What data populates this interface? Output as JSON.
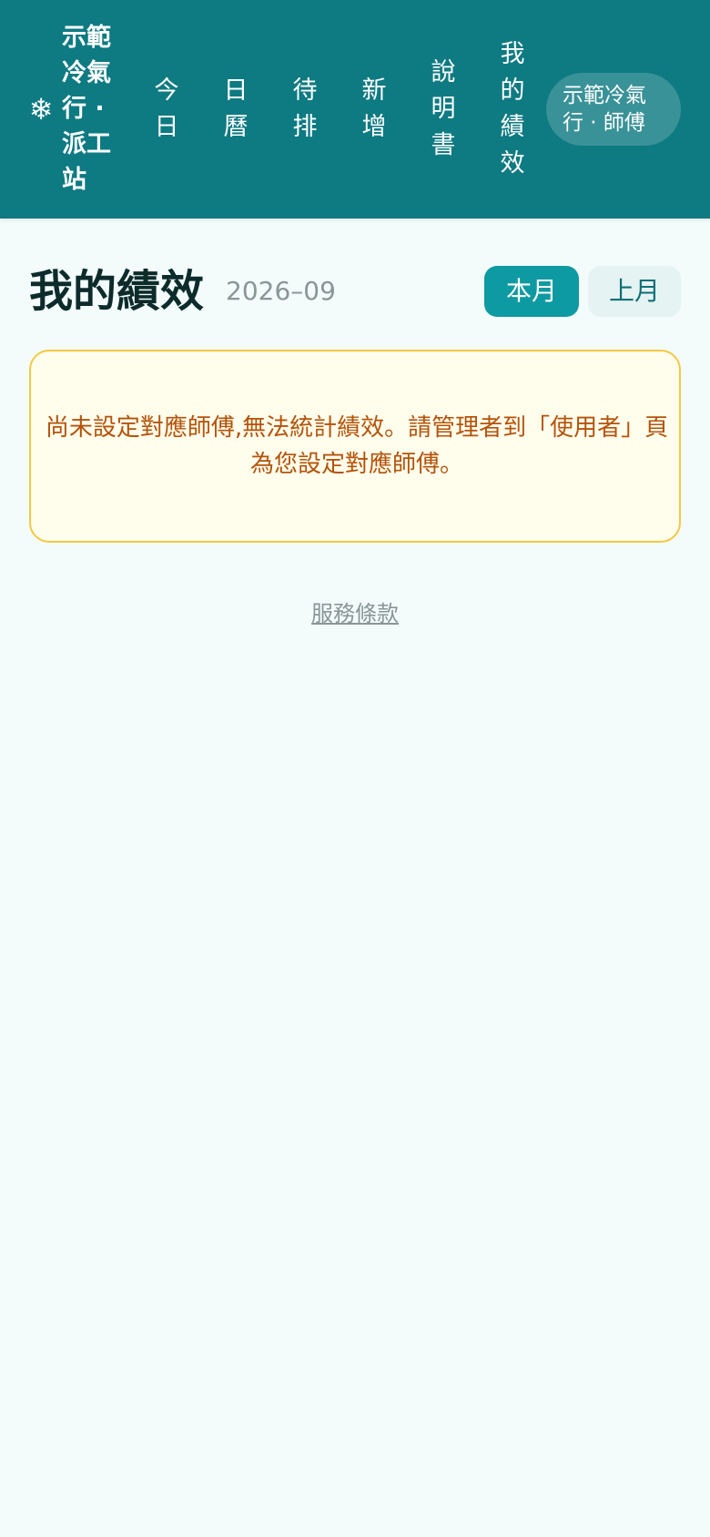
{
  "header": {
    "brand_icon": "❄",
    "brand_icon_name": "snowflake-icon",
    "brand_name": "示範冷氣行 · 派工站",
    "nav": [
      {
        "label": "今日"
      },
      {
        "label": "日曆"
      },
      {
        "label": "待排"
      },
      {
        "label": "新增"
      },
      {
        "label": "說明書"
      },
      {
        "label": "我的績效"
      }
    ],
    "user_label": "示範冷氣行 · 師傅"
  },
  "main": {
    "title": "我的績效",
    "period": "2026–09",
    "buttons": {
      "this_month": "本月",
      "last_month": "上月"
    },
    "notice": "尚未設定對應師傅,無法統計績效。請管理者到「使用者」頁為您設定對應師傅。"
  },
  "footer": {
    "terms_link": "服務條款"
  },
  "colors": {
    "header_bg": "#0e7a82",
    "accent": "#0e9aa2",
    "page_bg": "#f3fbfb",
    "notice_border": "#f5c842",
    "notice_bg": "#fffdec",
    "notice_text": "#b45309"
  }
}
